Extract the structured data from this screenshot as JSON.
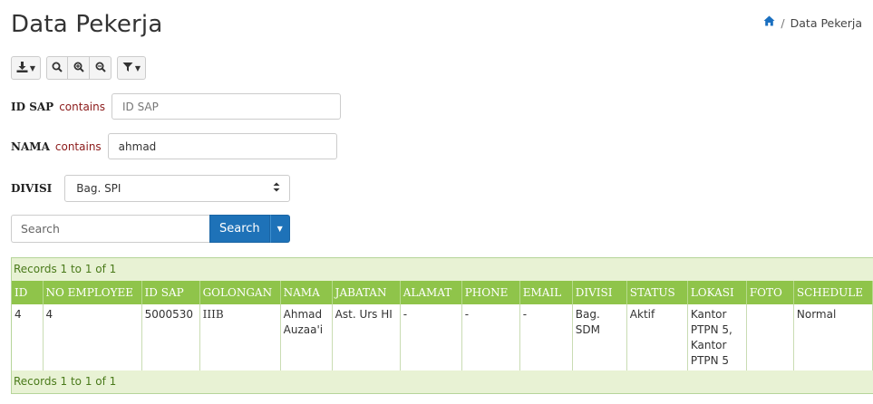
{
  "page": {
    "title": "Data Pekerja",
    "breadcrumb": {
      "current": "Data Pekerja",
      "separator": "/"
    }
  },
  "toolbar": {
    "export_icon": "download-icon",
    "search_icon": "search-icon",
    "zoom_in_icon": "zoom-in-icon",
    "zoom_out_icon": "zoom-out-icon",
    "filter_icon": "filter-icon"
  },
  "filters": {
    "id_sap": {
      "label": "ID SAP",
      "operator": "contains",
      "value": "",
      "placeholder": "ID SAP"
    },
    "nama": {
      "label": "NAMA",
      "operator": "contains",
      "value": "ahmad",
      "placeholder": ""
    },
    "divisi": {
      "label": "DIVISI",
      "selected": "Bag. SPI"
    }
  },
  "search": {
    "placeholder": "Search",
    "button_label": "Search"
  },
  "grid": {
    "records_top": "Records 1 to 1 of 1",
    "records_bottom": "Records 1 to 1 of 1",
    "columns": [
      "ID",
      "NO EMPLOYEE",
      "ID SAP",
      "GOLONGAN",
      "NAMA",
      "JABATAN",
      "ALAMAT",
      "PHONE",
      "EMAIL",
      "DIVISI",
      "STATUS",
      "LOKASI",
      "FOTO",
      "SCHEDULE"
    ],
    "rows": [
      {
        "id": "4",
        "no_employee": "4",
        "id_sap": "5000530",
        "golongan": "IIIB",
        "nama": "Ahmad Auzaa'i",
        "jabatan": "Ast. Urs HI",
        "alamat": "-",
        "phone": "-",
        "email": "-",
        "divisi": "Bag. SDM",
        "status": "Aktif",
        "lokasi": "Kantor PTPN 5, Kantor PTPN 5",
        "foto": "",
        "schedule": "Normal"
      }
    ]
  },
  "colors": {
    "header_green": "#8fc44a",
    "records_bg": "#e8f2d4",
    "primary_blue": "#1e72b8"
  }
}
